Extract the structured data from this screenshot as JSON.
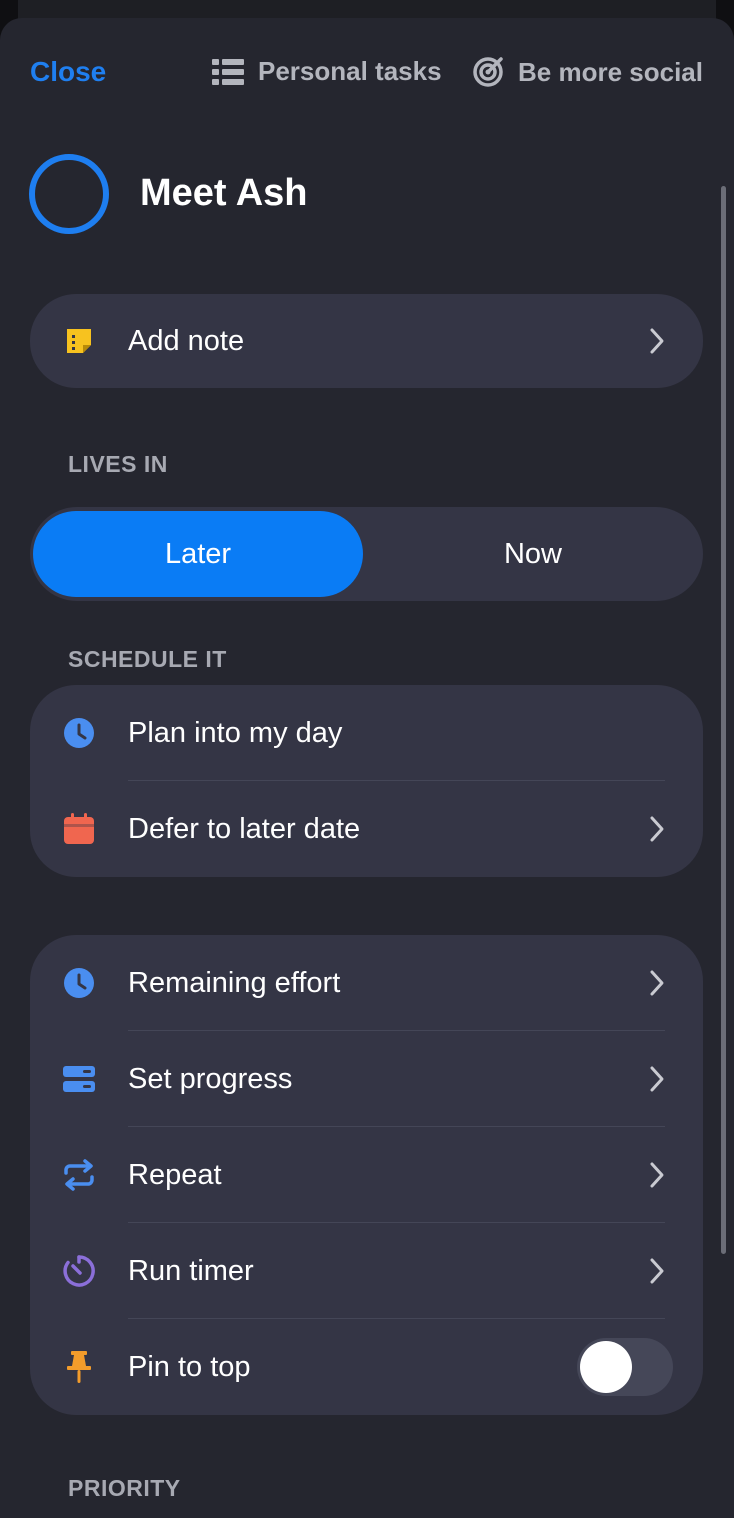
{
  "header": {
    "close_label": "Close",
    "project_label": "Personal tasks",
    "project_icon": "list-icon",
    "goal_label": "Be more social",
    "goal_icon": "target-icon"
  },
  "task": {
    "title": "Meet Ash",
    "completed": false
  },
  "note": {
    "label": "Add note",
    "icon": "note-icon",
    "icon_color": "#f7c21f"
  },
  "lives_in": {
    "section_label": "LIVES IN",
    "options": [
      "Later",
      "Now"
    ],
    "selected": "Later"
  },
  "schedule": {
    "section_label": "SCHEDULE IT",
    "items": [
      {
        "label": "Plan into my day",
        "icon": "clock-icon",
        "icon_color": "#4a8ef0"
      },
      {
        "label": "Defer to later date",
        "icon": "calendar-icon",
        "icon_color": "#f0664f"
      }
    ]
  },
  "options": {
    "items": [
      {
        "label": "Remaining effort",
        "icon": "clock-icon",
        "icon_color": "#4a8ef0"
      },
      {
        "label": "Set progress",
        "icon": "progress-icon",
        "icon_color": "#4a8ef0"
      },
      {
        "label": "Repeat",
        "icon": "repeat-icon",
        "icon_color": "#4a8ef0"
      },
      {
        "label": "Run timer",
        "icon": "timer-icon",
        "icon_color": "#8b6fd9"
      },
      {
        "label": "Pin to top",
        "icon": "pin-icon",
        "icon_color": "#f39c2b",
        "toggle_on": false
      }
    ]
  },
  "priority": {
    "section_label": "PRIORITY"
  }
}
